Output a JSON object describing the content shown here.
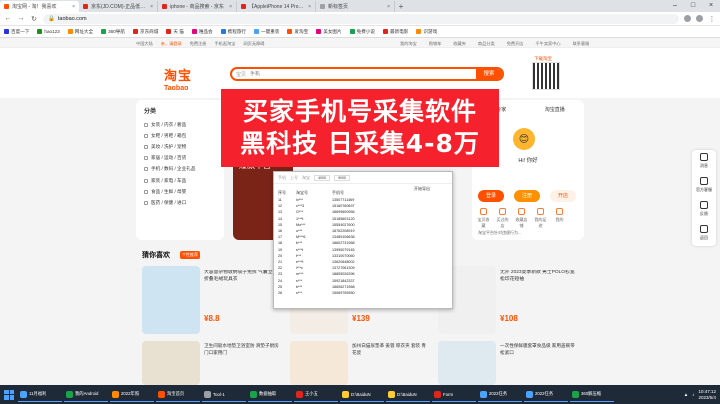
{
  "browser": {
    "tabs": [
      {
        "title": "淘宝网 - 淘！我喜欢",
        "color": "#ff5000",
        "active": true
      },
      {
        "title": "京东(JD.COM)-正品低价、品质保障",
        "color": "#e1251b"
      },
      {
        "title": "iphone - 商品搜索 - 京东",
        "color": "#e1251b"
      },
      {
        "title": "【AppleiPhone 14 Pro】Apple",
        "color": "#e1251b"
      },
      {
        "title": "新标签页",
        "color": "#9aa0a6"
      }
    ],
    "new_tab": "+",
    "url": "taobao.com",
    "bookmarks": [
      {
        "label": "百度一下",
        "color": "#2932e1"
      },
      {
        "label": "hao123",
        "color": "#1d8f1d"
      },
      {
        "label": "网址大全",
        "color": "#ff8a00"
      },
      {
        "label": "360导航",
        "color": "#19a34a"
      },
      {
        "label": "京东商城",
        "color": "#e1251b"
      },
      {
        "label": "天 猫",
        "color": "#e1251b"
      },
      {
        "label": "唯品会",
        "color": "#e5007e"
      },
      {
        "label": "携程旅行",
        "color": "#2577e3"
      },
      {
        "label": "一键重装",
        "color": "#4aa3ff"
      },
      {
        "label": "爱淘宝",
        "color": "#ff5000"
      },
      {
        "label": "美女图片",
        "color": "#e5007e"
      },
      {
        "label": "免费小说",
        "color": "#19a34a"
      },
      {
        "label": "最新电影",
        "color": "#e1251b"
      },
      {
        "label": "识游戏",
        "color": "#ff8a00"
      }
    ]
  },
  "site": {
    "topnav_left": [
      "中国大陆",
      "亲，请登录",
      "免费注册",
      "手机逛淘宝",
      "网页无障碍"
    ],
    "topnav_right": [
      "我的淘宝",
      "购物车",
      "收藏夹",
      "商品分类",
      "免费开店",
      "千牛卖家中心",
      "联系客服"
    ],
    "logo_cn": "淘宝",
    "logo_en": "Taobao",
    "search_tab": "宝贝",
    "search_placeholder": "手机",
    "search_button": "搜索",
    "qr_label": "下载淘宝",
    "categories_title": "分类",
    "categories": [
      "女装 / 内衣 / 奢品",
      "女鞋 / 男鞋 / 箱包",
      "美妆 / 洗护 / 宠物",
      "家居 / 运动 / 百货",
      "手机 / 数码 / 企业礼品",
      "家装 / 家电 / 车品",
      "食品 / 生鲜 / 母婴",
      "医药 / 保健 / 进口"
    ],
    "banner_text1": "手机",
    "banner_text2": "爆款不含",
    "user_tabs": [
      "领专家",
      "淘宝直播"
    ],
    "greeting": "Hi! 你好",
    "login": "登录",
    "register": "注册",
    "open_shop": "开店",
    "user_icons": [
      "宝贝收藏",
      "买过的店",
      "收藏店铺",
      "我的足迹",
      "我的"
    ],
    "notice": "淘宝平台针对违规行为..."
  },
  "overlay": {
    "line1": "买家手机号采集软件",
    "line2": "黑科技 日采集4-8万",
    "bg": "#f5222d"
  },
  "app": {
    "bar": [
      "手机",
      "上号",
      "淘宝",
      "4000",
      "9000"
    ],
    "export": "开始导出",
    "columns": [
      "序号",
      "淘宝号",
      "手机号"
    ],
    "rows": [
      [
        "11",
        "lx***",
        "13507711469"
      ],
      [
        "12",
        "c***3",
        "15160760697"
      ],
      [
        "13",
        "G***",
        "18699600956"
      ],
      [
        "14",
        "1***t",
        "15185603120"
      ],
      [
        "15",
        "Mo***",
        "15554027600"
      ],
      [
        "16",
        "u***",
        "18762208919"
      ],
      [
        "17",
        "M***6",
        "13489106638"
      ],
      [
        "18",
        "b***",
        "18602731968"
      ],
      [
        "19",
        "s***t",
        "13995079145"
      ],
      [
        "20",
        "t***",
        "13310070060"
      ],
      [
        "21",
        "e***t",
        "13620648002"
      ],
      [
        "22",
        "l***c",
        "13727061309"
      ],
      [
        "23",
        "m***",
        "18805026396"
      ],
      [
        "24",
        "s***",
        "15921842337"
      ],
      [
        "25",
        "b***",
        "18606271968"
      ],
      [
        "26",
        "s***",
        "15069755950"
      ]
    ]
  },
  "guess": {
    "title": "猜你喜欢",
    "badge": "个性推荐",
    "items": [
      {
        "title": "大容量杂物收纳袋子免拆 气囊立体折叠毛绒玩具衣",
        "price": "¥8.8",
        "color": "#cfe4f2"
      },
      {
        "title": "小熊电饭煲家用迷你 电饭锅1-2人小型",
        "price": "¥139",
        "color": "#f4ede6"
      },
      {
        "title": "无外 2023夏季新款 男士POLO衫宽松印花短袖",
        "price": "¥108",
        "color": "#f0f0f0"
      }
    ],
    "items2": [
      {
        "title": "卫生间吸水地垫卫浴室防 滑垫子厨房门口家用门",
        "color": "#e8e0d0"
      },
      {
        "title": "加州白猫尿垫革 姜蓉 晾衣夹 套装 青花瓷",
        "color": "#f6e8d8"
      },
      {
        "title": "一次性保鲜膜套罩食品级 家用盖碗带松紧口",
        "color": "#dfe9f0"
      }
    ]
  },
  "rightbar": [
    "消息",
    "官方客服",
    "反馈",
    "返回"
  ],
  "taskbar": {
    "items": [
      {
        "label": "11月福利",
        "color": "#4aa3ff"
      },
      {
        "label": "我的Android",
        "color": "#19a34a"
      },
      {
        "label": "2022年照",
        "color": "#ff8a00"
      },
      {
        "label": "淘宝首页",
        "color": "#ff5000"
      },
      {
        "label": "Tool-1",
        "color": "#9aa0a6"
      },
      {
        "label": "数据抽取",
        "color": "#19a34a"
      },
      {
        "label": "王小五",
        "color": "#e1251b"
      },
      {
        "label": "D:\\BaiduN",
        "color": "#ffcc33"
      },
      {
        "label": "D:\\BaiduN",
        "color": "#ffcc33"
      },
      {
        "label": "Form",
        "color": "#e1251b"
      },
      {
        "label": "2022任务",
        "color": "#4aa3ff"
      },
      {
        "label": "2022任务",
        "color": "#4aa3ff"
      },
      {
        "label": "360解压缩",
        "color": "#19a34a"
      }
    ],
    "time": "10:47:12",
    "date": "2023/5/4"
  }
}
